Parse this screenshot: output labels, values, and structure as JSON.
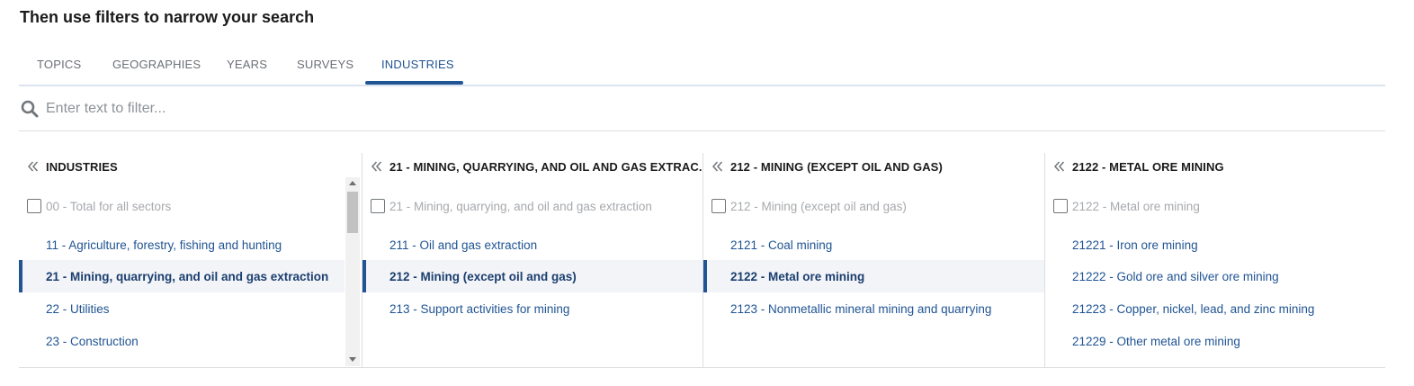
{
  "heading": "Then use filters to narrow your search",
  "tabs": [
    "TOPICS",
    "GEOGRAPHIES",
    "YEARS",
    "SURVEYS",
    "INDUSTRIES"
  ],
  "active_tab": "INDUSTRIES",
  "filter": {
    "placeholder": "Enter text to filter..."
  },
  "columns": [
    {
      "title": "INDUSTRIES",
      "all_label": "00 - Total for all sectors",
      "items": [
        "11 - Agriculture, forestry, fishing and hunting",
        "21 - Mining, quarrying, and oil and gas extraction",
        "22 - Utilities",
        "23 - Construction"
      ],
      "selected": "21 - Mining, quarrying, and oil and gas extraction"
    },
    {
      "title": "21 - MINING, QUARRYING, AND OIL AND GAS EXTRAC...",
      "all_label": "21 - Mining, quarrying, and oil and gas extraction",
      "items": [
        "211 - Oil and gas extraction",
        "212 - Mining (except oil and gas)",
        "213 - Support activities for mining"
      ],
      "selected": "212 - Mining (except oil and gas)"
    },
    {
      "title": "212 - MINING (EXCEPT OIL AND GAS)",
      "all_label": "212 - Mining (except oil and gas)",
      "items": [
        "2121 - Coal mining",
        "2122 - Metal ore mining",
        "2123 - Nonmetallic mineral mining and quarrying"
      ],
      "selected": "2122 - Metal ore mining"
    },
    {
      "title": "2122 - METAL ORE MINING",
      "all_label": "2122 - Metal ore mining",
      "items": [
        "21221 - Iron ore mining",
        "21222 - Gold ore and silver ore mining",
        "21223 - Copper, nickel, lead, and zinc mining",
        "21229 - Other metal ore mining"
      ],
      "selected": ""
    }
  ],
  "colors": {
    "accent": "#205493",
    "selected_bg": "#f2f4f7",
    "muted": "#a6a9ad"
  }
}
